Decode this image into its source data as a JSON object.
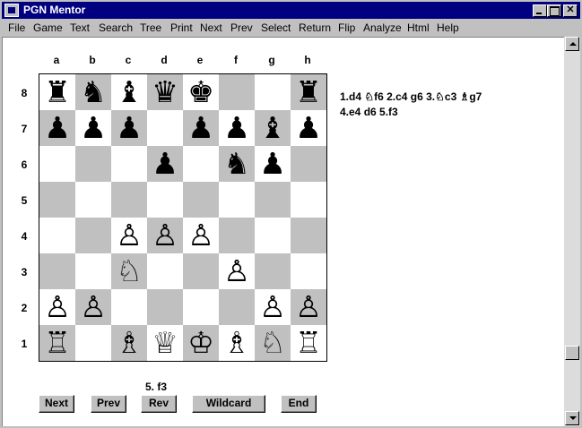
{
  "window": {
    "title": "PGN Mentor"
  },
  "menu": [
    "File",
    "Game",
    "Text",
    "Search",
    "Tree",
    "Print",
    "Next",
    "Prev",
    "Select",
    "Return",
    "Flip",
    "Analyze",
    "Html",
    "Help"
  ],
  "board": {
    "files": [
      "a",
      "b",
      "c",
      "d",
      "e",
      "f",
      "g",
      "h"
    ],
    "ranks": [
      "8",
      "7",
      "6",
      "5",
      "4",
      "3",
      "2",
      "1"
    ],
    "rows": [
      [
        "♜",
        "♞",
        "♝",
        "♛",
        "♚",
        "",
        "",
        "♜"
      ],
      [
        "♟",
        "♟",
        "♟",
        "",
        "♟",
        "♟",
        "♝",
        "♟"
      ],
      [
        "",
        "",
        "",
        "♟",
        "",
        "♞",
        "♟",
        ""
      ],
      [
        "",
        "",
        "",
        "",
        "",
        "",
        "",
        ""
      ],
      [
        "",
        "",
        "♙",
        "♙",
        "♙",
        "",
        "",
        ""
      ],
      [
        "",
        "",
        "♘",
        "",
        "",
        "♙",
        "",
        ""
      ],
      [
        "♙",
        "♙",
        "",
        "",
        "",
        "",
        "♙",
        "♙"
      ],
      [
        "♖",
        "",
        "♗",
        "♕",
        "♔",
        "♗",
        "♘",
        "♖"
      ]
    ]
  },
  "moves": {
    "line1": "1.d4 ♘f6 2.c4 g6 3.♘c3 ♗g7",
    "line2": "4.e4 d6 5.f3"
  },
  "current_move": "5. f3",
  "buttons": {
    "next": "Next",
    "prev": "Prev",
    "rev": "Rev",
    "wildcard": "Wildcard",
    "end": "End"
  }
}
